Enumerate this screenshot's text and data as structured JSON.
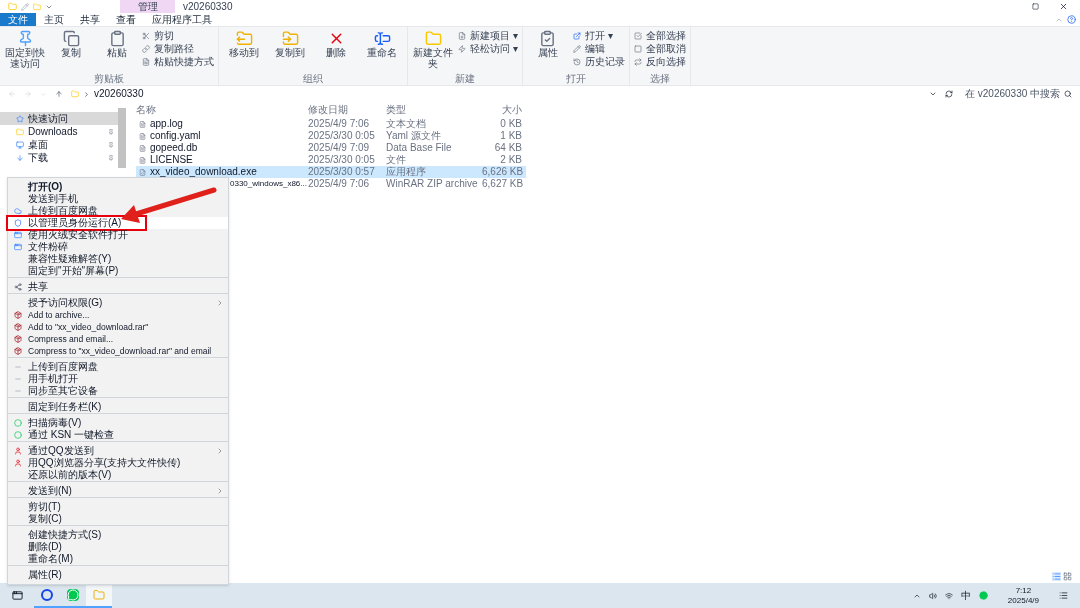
{
  "title_bar": {
    "contextual_tab": "管理",
    "title": "v20260330"
  },
  "ribbon_tabs": [
    {
      "label": "文件",
      "selected": true
    },
    {
      "label": "主页",
      "selected": false
    },
    {
      "label": "共享",
      "selected": false
    },
    {
      "label": "查看",
      "selected": false
    },
    {
      "label": "应用程序工具",
      "selected": false
    }
  ],
  "ribbon_groups": [
    {
      "label": "剪贴板",
      "large": [
        "固定到快速访问",
        "复制",
        "粘贴"
      ],
      "small": [
        "剪切",
        "复制路径",
        "粘贴快捷方式"
      ]
    },
    {
      "label": "组织",
      "large": [
        "移动到",
        "复制到",
        "删除",
        "重命名"
      ]
    },
    {
      "label": "新建",
      "large": [
        "新建文件夹"
      ],
      "small": [
        "新建项目 ▾",
        "轻松访问 ▾"
      ]
    },
    {
      "label": "打开",
      "large": [
        "属性"
      ],
      "small": [
        "打开 ▾",
        "编辑",
        "历史记录"
      ]
    },
    {
      "label": "选择",
      "small": [
        "全部选择",
        "全部取消",
        "反向选择"
      ]
    }
  ],
  "address": {
    "path": "v20260330",
    "search_placeholder": "在 v20260330 中搜索"
  },
  "nav": [
    {
      "label": "快速访问",
      "selected": true,
      "pinned": false
    },
    {
      "label": "Downloads",
      "selected": false,
      "pinned": true
    },
    {
      "label": "桌面",
      "selected": false,
      "pinned": true
    },
    {
      "label": "下载",
      "selected": false,
      "pinned": true
    }
  ],
  "columns": [
    "名称",
    "修改日期",
    "类型",
    "大小"
  ],
  "files": [
    {
      "name": "app.log",
      "date": "2025/4/9 7:06",
      "type": "文本文档",
      "size": "0 KB",
      "selected": false,
      "kind": "file"
    },
    {
      "name": "config.yaml",
      "date": "2025/3/30 0:05",
      "type": "Yaml 源文件",
      "size": "1 KB",
      "selected": false,
      "kind": "file"
    },
    {
      "name": "gopeed.db",
      "date": "2025/4/9 7:09",
      "type": "Data Base File",
      "size": "64 KB",
      "selected": false,
      "kind": "file"
    },
    {
      "name": "LICENSE",
      "date": "2025/3/30 0:05",
      "type": "文件",
      "size": "2 KB",
      "selected": false,
      "kind": "file"
    },
    {
      "name": "xx_video_download.exe",
      "date": "2025/3/30 0:57",
      "type": "应用程序",
      "size": "6,626 KB",
      "selected": true,
      "kind": "program"
    },
    {
      "name": "0330_windows_x86...",
      "date": "2025/4/9 7:06",
      "type": "WinRAR ZIP archive",
      "size": "6,627 KB",
      "selected": false,
      "kind": "covered"
    }
  ],
  "context_menu": [
    {
      "label": "打开(O)",
      "kind": "plain",
      "bold": true,
      "submenu": false,
      "highlighted": false,
      "boxed": false,
      "sep": false
    },
    {
      "label": "发送到手机",
      "kind": "plain",
      "bold": false,
      "submenu": false,
      "highlighted": false,
      "boxed": false,
      "sep": false
    },
    {
      "label": "上传到百度网盘",
      "kind": "cloud",
      "bold": false,
      "submenu": false,
      "highlighted": false,
      "boxed": false,
      "sep": false
    },
    {
      "label": "以管理员身份运行(A)",
      "kind": "admin",
      "bold": false,
      "submenu": false,
      "highlighted": true,
      "boxed": true,
      "sep": false
    },
    {
      "label": "使用火绒安全软件打开",
      "kind": "app",
      "bold": false,
      "submenu": false,
      "highlighted": false,
      "boxed": false,
      "sep": false
    },
    {
      "label": "文件粉碎",
      "kind": "app",
      "bold": false,
      "submenu": false,
      "highlighted": false,
      "boxed": false,
      "sep": false
    },
    {
      "label": "兼容性疑难解答(Y)",
      "kind": "plain",
      "bold": false,
      "submenu": false,
      "highlighted": false,
      "boxed": false,
      "sep": false
    },
    {
      "label": "固定到\"开始\"屏幕(P)",
      "kind": "plain",
      "bold": false,
      "submenu": false,
      "highlighted": false,
      "boxed": false,
      "sep": false
    },
    {
      "label": "共享",
      "kind": "share",
      "bold": false,
      "submenu": false,
      "highlighted": false,
      "boxed": false,
      "sep": true
    },
    {
      "label": "授予访问权限(G)",
      "kind": "plain",
      "bold": false,
      "submenu": true,
      "highlighted": false,
      "boxed": false,
      "sep": true
    },
    {
      "label": "Add to archive...",
      "kind": "archive",
      "bold": false,
      "submenu": false,
      "highlighted": false,
      "boxed": false,
      "sep": false
    },
    {
      "label": "Add to \"xx_video_download.rar\"",
      "kind": "archive",
      "bold": false,
      "submenu": false,
      "highlighted": false,
      "boxed": false,
      "sep": false
    },
    {
      "label": "Compress and email...",
      "kind": "archive",
      "bold": false,
      "submenu": false,
      "highlighted": false,
      "boxed": false,
      "sep": false
    },
    {
      "label": "Compress to \"xx_video_download.rar\" and email",
      "kind": "archive",
      "bold": false,
      "submenu": false,
      "highlighted": false,
      "boxed": false,
      "sep": false
    },
    {
      "label": "上传到百度网盘",
      "kind": "mini",
      "bold": false,
      "submenu": false,
      "highlighted": false,
      "boxed": false,
      "sep": true
    },
    {
      "label": "用手机打开",
      "kind": "mini",
      "bold": false,
      "submenu": false,
      "highlighted": false,
      "boxed": false,
      "sep": false
    },
    {
      "label": "同步至其它设备",
      "kind": "mini",
      "bold": false,
      "submenu": false,
      "highlighted": false,
      "boxed": false,
      "sep": false
    },
    {
      "label": "固定到任务栏(K)",
      "kind": "plain",
      "bold": false,
      "submenu": false,
      "highlighted": false,
      "boxed": false,
      "sep": true
    },
    {
      "label": "扫描病毒(V)",
      "kind": "scan",
      "bold": false,
      "submenu": false,
      "highlighted": false,
      "boxed": false,
      "sep": true
    },
    {
      "label": "通过 KSN 一键检查",
      "kind": "scan",
      "bold": false,
      "submenu": false,
      "highlighted": false,
      "boxed": false,
      "sep": false
    },
    {
      "label": "通过QQ发送到",
      "kind": "qq",
      "bold": false,
      "submenu": true,
      "highlighted": false,
      "boxed": false,
      "sep": true
    },
    {
      "label": "用QQ浏览器分享(支持大文件快传)",
      "kind": "qq",
      "bold": false,
      "submenu": false,
      "highlighted": false,
      "boxed": false,
      "sep": false
    },
    {
      "label": "还原以前的版本(V)",
      "kind": "plain",
      "bold": false,
      "submenu": false,
      "highlighted": false,
      "boxed": false,
      "sep": false
    },
    {
      "label": "发送到(N)",
      "kind": "plain",
      "bold": false,
      "submenu": true,
      "highlighted": false,
      "boxed": false,
      "sep": true
    },
    {
      "label": "剪切(T)",
      "kind": "plain",
      "bold": false,
      "submenu": false,
      "highlighted": false,
      "boxed": false,
      "sep": true
    },
    {
      "label": "复制(C)",
      "kind": "plain",
      "bold": false,
      "submenu": false,
      "highlighted": false,
      "boxed": false,
      "sep": false
    },
    {
      "label": "创建快捷方式(S)",
      "kind": "plain",
      "bold": false,
      "submenu": false,
      "highlighted": false,
      "boxed": false,
      "sep": true
    },
    {
      "label": "删除(D)",
      "kind": "plain",
      "bold": false,
      "submenu": false,
      "highlighted": false,
      "boxed": false,
      "sep": false
    },
    {
      "label": "重命名(M)",
      "kind": "plain",
      "bold": false,
      "submenu": false,
      "highlighted": false,
      "boxed": false,
      "sep": false
    },
    {
      "label": "属性(R)",
      "kind": "plain",
      "bold": false,
      "submenu": false,
      "highlighted": false,
      "boxed": false,
      "sep": true
    }
  ],
  "taskbar": {
    "apps": [
      {
        "active": false
      },
      {
        "active": false
      },
      {
        "active": true
      }
    ],
    "ime": "中",
    "time": "7:12",
    "date": "2025/4/9"
  }
}
